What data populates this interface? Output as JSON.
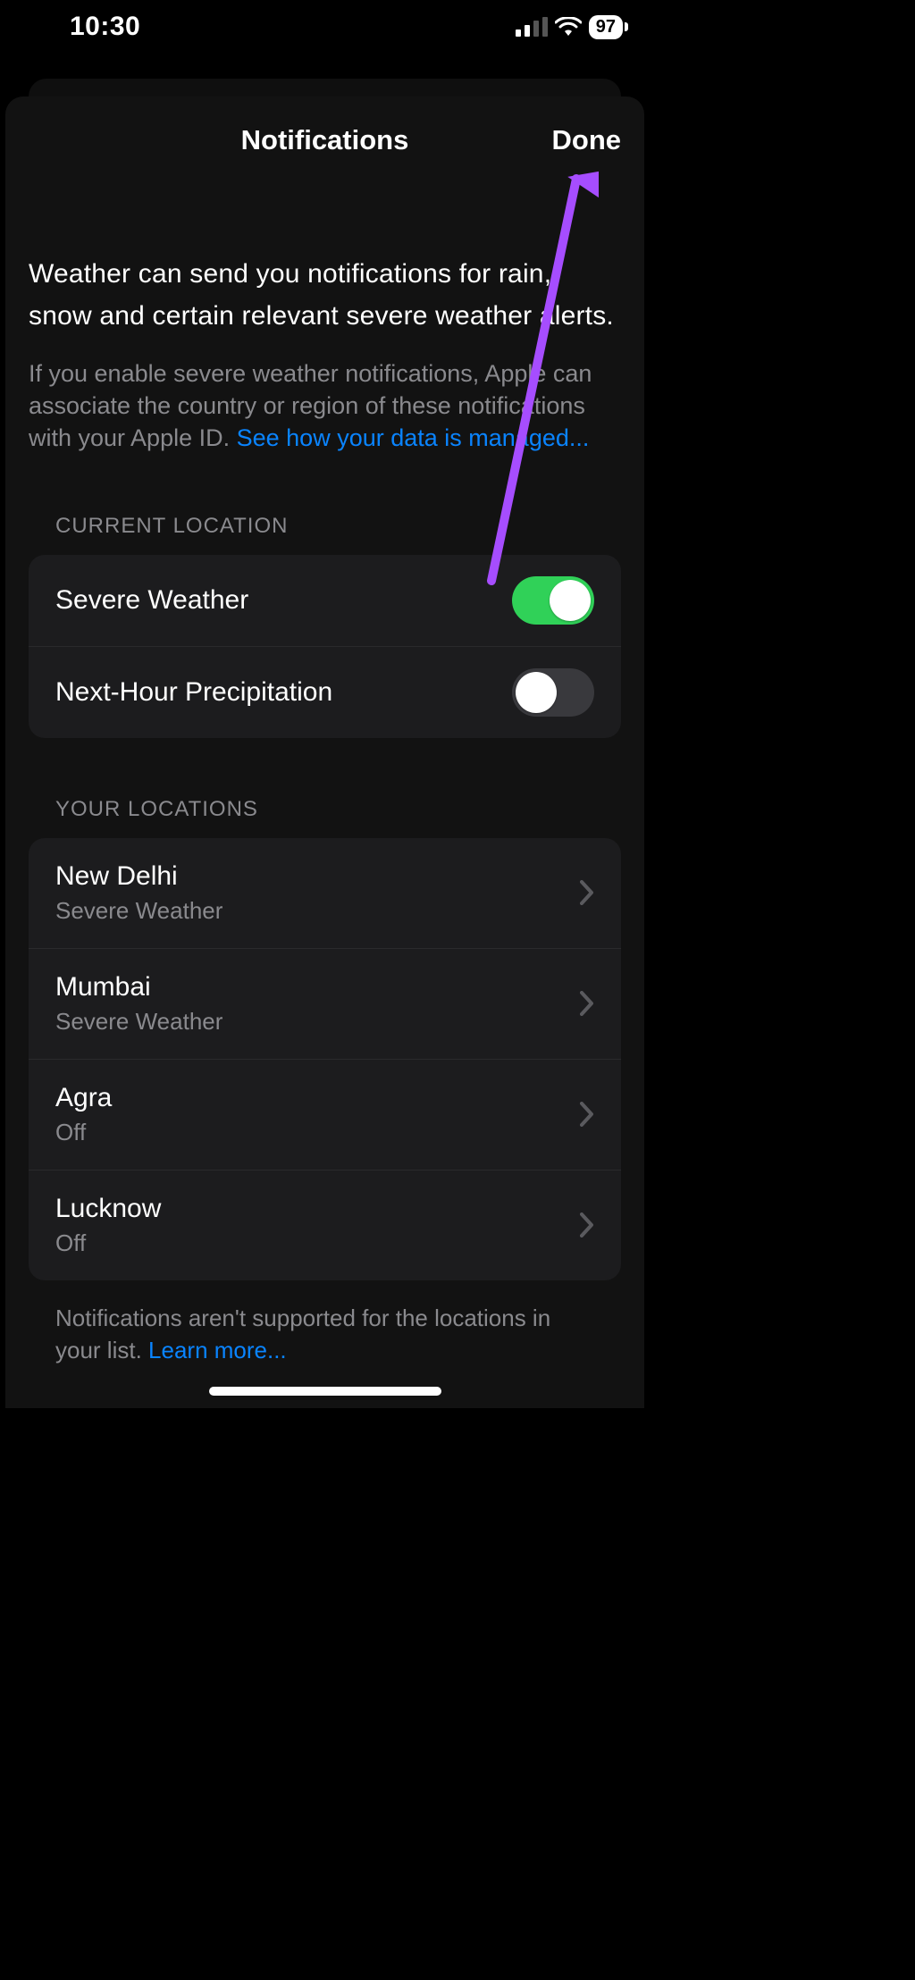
{
  "status": {
    "time": "10:30",
    "battery": "97"
  },
  "header": {
    "title": "Notifications",
    "done": "Done"
  },
  "description": "Weather can send you notifications for rain, snow and certain relevant severe weather alerts.",
  "subdescription_prefix": "If you enable severe weather notifications, Apple can associate the country or region of these notifications with your Apple ID. ",
  "subdescription_link": "See how your data is managed...",
  "sections": {
    "current_location": {
      "label": "CURRENT LOCATION",
      "rows": [
        {
          "title": "Severe Weather",
          "on": true
        },
        {
          "title": "Next-Hour Precipitation",
          "on": false
        }
      ]
    },
    "your_locations": {
      "label": "YOUR LOCATIONS",
      "rows": [
        {
          "name": "New Delhi",
          "status": "Severe Weather"
        },
        {
          "name": "Mumbai",
          "status": "Severe Weather"
        },
        {
          "name": "Agra",
          "status": "Off"
        },
        {
          "name": "Lucknow",
          "status": "Off"
        }
      ],
      "footer_prefix": "Notifications aren't supported for the locations in your list. ",
      "footer_link": "Learn more..."
    }
  },
  "annotation": {
    "arrow_color": "#a64dff"
  }
}
